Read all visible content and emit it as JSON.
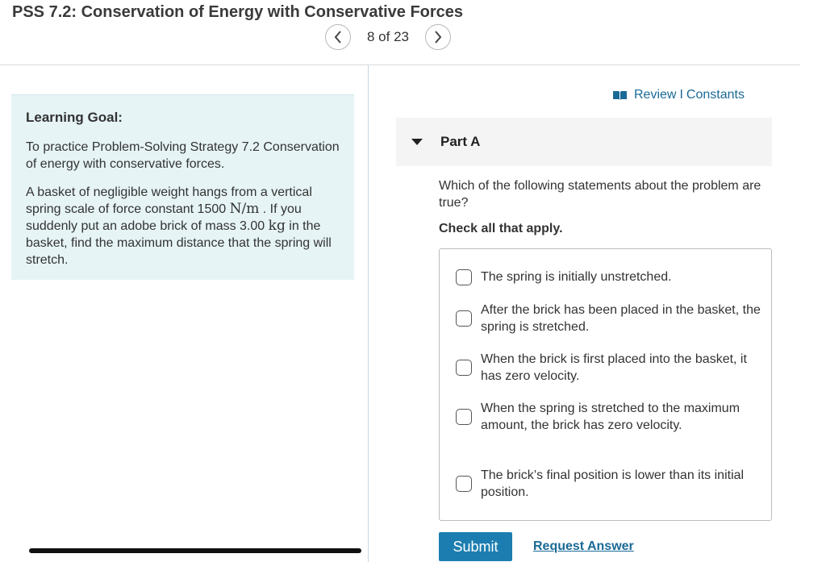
{
  "header": {
    "title": "PSS 7.2: Conservation of Energy with Conservative Forces",
    "pagination": "8 of 23"
  },
  "learning_goal": {
    "heading": "Learning Goal:",
    "para1": "To practice Problem-Solving Strategy 7.2 Conservation of energy with conservative forces.",
    "para2_a": "A basket of negligible weight hangs from a vertical spring scale of force constant 1500 ",
    "para2_unit1": "N/m",
    "para2_b": " . If you suddenly put an adobe brick of mass 3.00 ",
    "para2_unit2": "kg",
    "para2_c": " in the basket, find the maximum distance that the spring will stretch."
  },
  "links": {
    "review": "Review",
    "separator": "I",
    "constants": "Constants"
  },
  "part": {
    "title": "Part A",
    "question": "Which of the following statements about the problem are true?",
    "instruction": "Check all that apply.",
    "options": [
      "The spring is initially unstretched.",
      "After the brick has been placed in the basket, the spring is stretched.",
      "When the brick is first placed into the basket, it has zero velocity.",
      "When the spring is stretched to the maximum amount, the brick has zero velocity.",
      "The brick’s final position is lower than its initial position."
    ]
  },
  "actions": {
    "submit": "Submit",
    "request_answer": "Request Answer"
  },
  "colors": {
    "accent": "#1c7eb0",
    "link": "#1a6a96",
    "goal_background": "#e6f4f6"
  }
}
